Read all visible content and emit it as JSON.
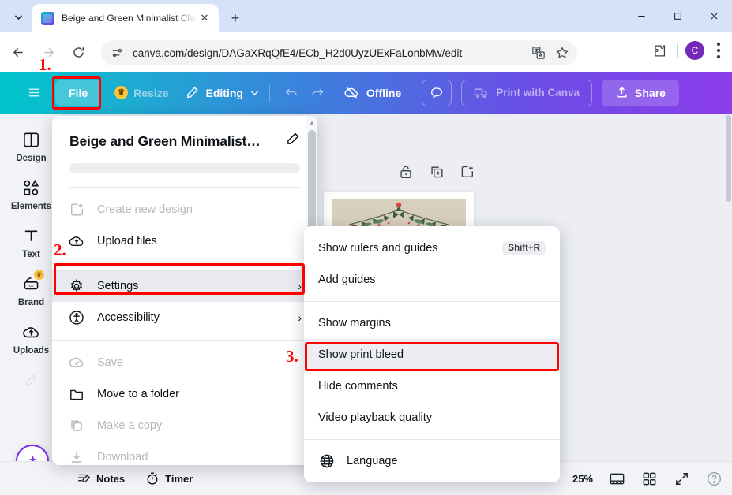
{
  "browser": {
    "tab": {
      "title": "Beige and Green Minimalist Chr",
      "close_label": "✕"
    },
    "new_tab_label": "+",
    "window": {
      "minimize": "─",
      "maximize": "□",
      "close": "✕"
    },
    "omnibox": {
      "url": "canva.com/design/DAGaXRqQfE4/ECb_H2d0UyzUExFaLonbMw/edit",
      "site_info_icon": "page-settings-icon",
      "translate_icon": "translate-icon",
      "bookmark_icon": "star-icon"
    },
    "extensions_icon": "extensions-puzzle-icon",
    "profile_initial": "C",
    "menu_icon": "three-dot-menu-icon",
    "nav": {
      "back": "back-arrow",
      "forward": "forward-arrow",
      "reload": "reload-arrow"
    }
  },
  "canva_toolbar": {
    "menu_icon": "hamburger-icon",
    "file_label": "File",
    "resize_label": "Resize",
    "editing_label": "Editing",
    "undo_icon": "undo-icon",
    "redo_icon": "redo-icon",
    "offline_label": "Offline",
    "comment_icon": "comment-bubble-icon",
    "print_label": "Print with Canva",
    "share_label": "Share"
  },
  "rail": {
    "items": [
      {
        "label": "Design",
        "icon": "design-panel-icon"
      },
      {
        "label": "Elements",
        "icon": "shapes-icon"
      },
      {
        "label": "Text",
        "icon": "text-t-icon"
      },
      {
        "label": "Brand",
        "icon": "brand-kit-icon",
        "pro": true
      },
      {
        "label": "Uploads",
        "icon": "upload-cloud-icon"
      }
    ],
    "draw_icon": "pen-draw-icon",
    "magic_icon": "magic-sparkle-icon"
  },
  "canvas": {
    "page_tools": [
      {
        "icon": "unlock-icon"
      },
      {
        "icon": "duplicate-page-icon"
      },
      {
        "icon": "add-page-icon"
      }
    ]
  },
  "file_menu": {
    "design_title": "Beige and Green Minimalist…",
    "edit_icon": "pencil-icon",
    "items": [
      {
        "label": "Create new design",
        "icon": "new-design-icon",
        "disabled": true,
        "chevron": false
      },
      {
        "label": "Upload files",
        "icon": "upload-cloud-icon",
        "disabled": false,
        "chevron": false
      },
      {
        "label": "Settings",
        "icon": "gear-icon",
        "disabled": false,
        "chevron": true,
        "selected": true
      },
      {
        "label": "Accessibility",
        "icon": "accessibility-icon",
        "disabled": false,
        "chevron": true
      },
      {
        "label": "Save",
        "icon": "cloud-check-icon",
        "disabled": true,
        "chevron": false
      },
      {
        "label": "Move to a folder",
        "icon": "folder-icon",
        "disabled": false,
        "chevron": false
      },
      {
        "label": "Make a copy",
        "icon": "copy-icon",
        "disabled": true,
        "chevron": false
      },
      {
        "label": "Download",
        "icon": "download-icon",
        "disabled": true,
        "chevron": false
      }
    ]
  },
  "submenu": {
    "items": [
      {
        "label": "Show rulers and guides",
        "shortcut": "Shift+R"
      },
      {
        "label": "Add guides",
        "shortcut": ""
      },
      {
        "label": "Show margins",
        "shortcut": ""
      },
      {
        "label": "Show print bleed",
        "shortcut": "",
        "selected": true
      },
      {
        "label": "Hide comments",
        "shortcut": ""
      },
      {
        "label": "Video playback quality",
        "shortcut": ""
      },
      {
        "label": "Language",
        "shortcut": "",
        "icon": "globe-icon"
      }
    ]
  },
  "bottom_bar": {
    "notes_label": "Notes",
    "timer_label": "Timer",
    "zoom_level": "25%",
    "page_view_icon": "page-view-icon",
    "grid_view_icon": "grid-view-icon",
    "fullscreen_icon": "fullscreen-icon",
    "help_icon": "help-icon"
  },
  "annotations": {
    "step1": "1.",
    "step2": "2.",
    "step3": "3.",
    "color": "#ff0000"
  }
}
